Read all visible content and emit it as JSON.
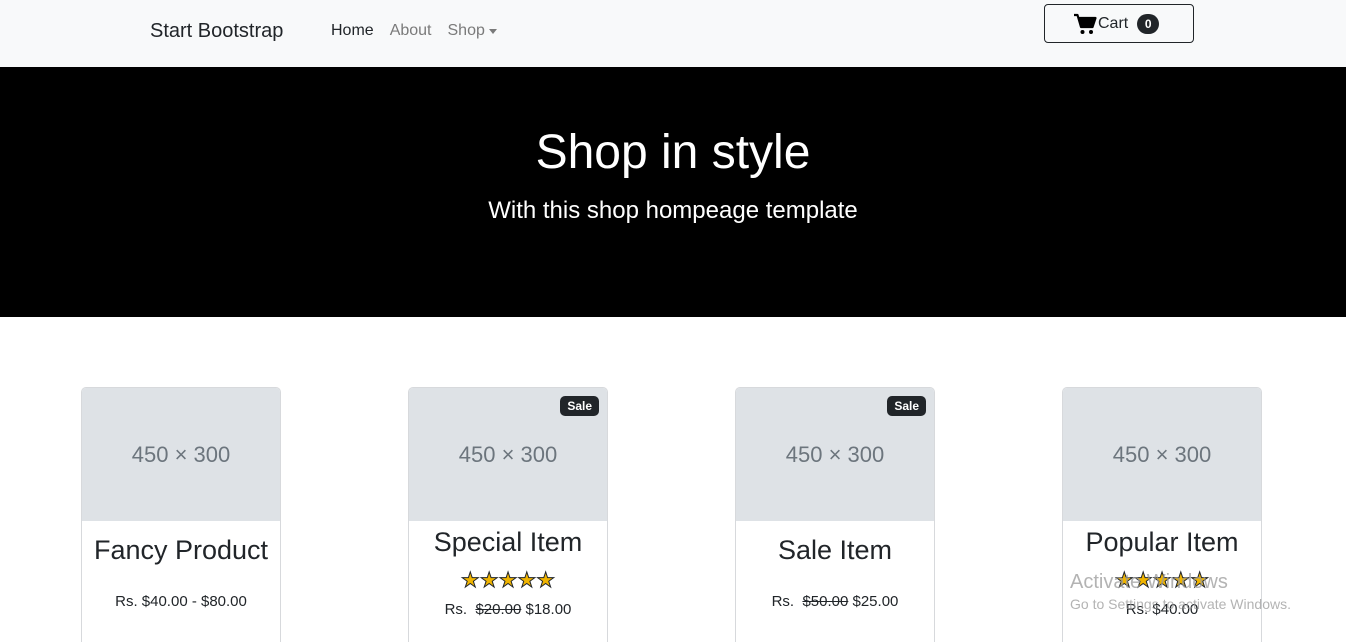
{
  "navbar": {
    "brand": "Start Bootstrap",
    "links": [
      {
        "label": "Home",
        "active": true
      },
      {
        "label": "About",
        "active": false
      },
      {
        "label": "Shop",
        "active": false
      }
    ],
    "cart": {
      "label": "Cart",
      "count": "0"
    }
  },
  "hero": {
    "title": "Shop in style",
    "subtitle": "With this shop hompeage template"
  },
  "products": [
    {
      "image_label": "450 × 300",
      "name": "Fancy Product",
      "price": "Rs. $40.00 - $80.00"
    },
    {
      "image_label": "450 × 300",
      "badge": "Sale",
      "name": "Special Item",
      "rating": 5,
      "price_prefix": "Rs.",
      "old_price": "$20.00",
      "new_price": "$18.00"
    },
    {
      "image_label": "450 × 300",
      "badge": "Sale",
      "name": "Sale Item",
      "price_prefix": "Rs.",
      "old_price": "$50.00",
      "new_price": "$25.00"
    },
    {
      "image_label": "450 × 300",
      "name": "Popular Item",
      "rating": 5,
      "price": "Rs. $40.00"
    }
  ],
  "watermark": {
    "line1": "Activate Windows",
    "line2": "Go to Settings to activate Windows."
  }
}
